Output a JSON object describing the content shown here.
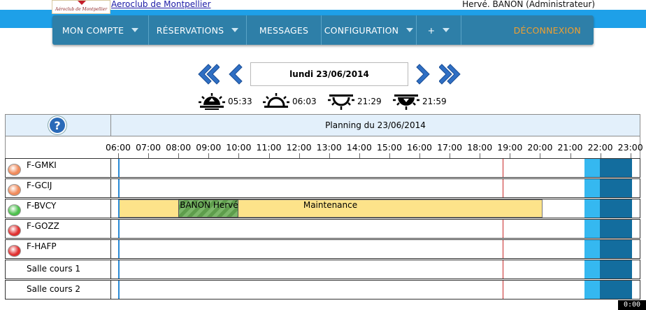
{
  "header": {
    "club_link": "Aeroclub de Montpellier",
    "logo_text": "Aéroclub de Montpellier",
    "user": "Hervé. BANON (Administrateur)"
  },
  "nav": [
    {
      "label": "MON COMPTE",
      "dropdown": true,
      "w": 138
    },
    {
      "label": "RÉSERVATIONS",
      "dropdown": true,
      "w": 140
    },
    {
      "label": "MESSAGES",
      "dropdown": false,
      "w": 107
    },
    {
      "label": "CONFIGURATION",
      "dropdown": true,
      "w": 136
    },
    {
      "label": "+",
      "dropdown": true,
      "w": 64
    },
    {
      "label": "DÉCONNEXION",
      "dropdown": false,
      "logout": true
    }
  ],
  "date": {
    "current": "lundi 23/06/2014"
  },
  "sun": {
    "dawn": "05:33",
    "sunrise": "06:03",
    "sunset": "21:29",
    "dusk": "21:59"
  },
  "planning": {
    "title": "Planning du 23/06/2014",
    "hours": [
      "06:00",
      "07:00",
      "08:00",
      "09:00",
      "10:00",
      "11:00",
      "12:00",
      "13:00",
      "14:00",
      "15:00",
      "16:00",
      "17:00",
      "18:00",
      "19:00",
      "20:00",
      "21:00",
      "22:00",
      "23:00"
    ],
    "rows": [
      {
        "name": "F-GMKI",
        "status": "orange",
        "status_color": "#f08a5a"
      },
      {
        "name": "F-GCIJ",
        "status": "orange",
        "status_color": "#f08a5a"
      },
      {
        "name": "F-BVCY",
        "status": "green",
        "status_color": "#4cc04c",
        "reservations": [
          {
            "type": "maintenance",
            "label": "Maintenance",
            "start": "06:00",
            "end": "20:05"
          },
          {
            "type": "flight",
            "label": "BANON Hervé",
            "start": "08:00",
            "end": "10:00"
          }
        ]
      },
      {
        "name": "F-GOZZ",
        "status": "red",
        "status_color": "#e03030"
      },
      {
        "name": "F-HAFP",
        "status": "red",
        "status_color": "#e03030"
      },
      {
        "name": "Salle cours 1",
        "status": null
      },
      {
        "name": "Salle cours 2",
        "status": null
      }
    ]
  },
  "clock": "0:00"
}
